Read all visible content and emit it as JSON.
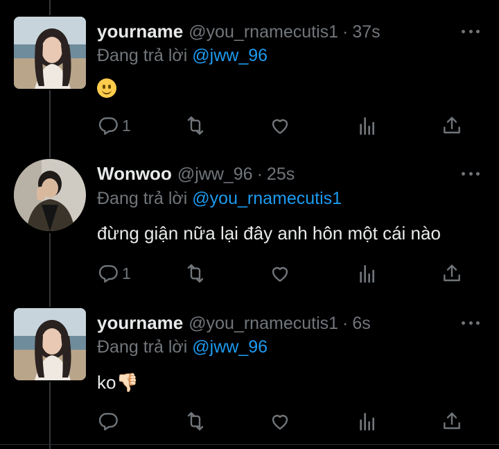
{
  "tweets": [
    {
      "display_name": "yourname",
      "handle": "@you_rnamecutis1",
      "separator": "·",
      "time": "37s",
      "reply_prefix": "Đang trả lời",
      "reply_to": "@jww_96",
      "text": "",
      "emoji": "slightly-smiling-face",
      "reply_count": "1",
      "avatar": "photo-girl-beach"
    },
    {
      "display_name": "Wonwoo",
      "handle": "@jww_96",
      "separator": "·",
      "time": "25s",
      "reply_prefix": "Đang trả lời",
      "reply_to": "@you_rnamecutis1",
      "text": "đừng giận nữa lại đây anh hôn một cái nào",
      "reply_count": "1",
      "avatar": "photo-man-jacket"
    },
    {
      "display_name": "yourname",
      "handle": "@you_rnamecutis1",
      "separator": "·",
      "time": "6s",
      "reply_prefix": "Đang trả lời",
      "reply_to": "@jww_96",
      "text": "ko👎🏻",
      "reply_count": "",
      "avatar": "photo-girl-beach"
    }
  ],
  "colors": {
    "background": "#000000",
    "text": "#e7e9ea",
    "muted": "#71767b",
    "link": "#1d9bf0"
  },
  "icons": [
    "reply-icon",
    "retweet-icon",
    "like-icon",
    "analytics-icon",
    "share-icon",
    "more-icon"
  ]
}
